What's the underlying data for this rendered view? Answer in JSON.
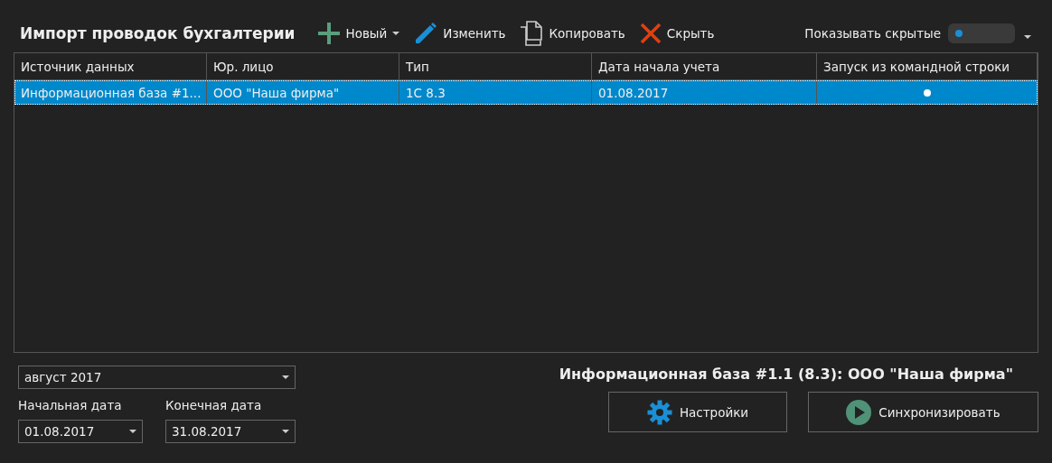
{
  "title": "Импорт проводок бухгалтерии",
  "toolbar": [
    {
      "kind": "add",
      "label": "Новый",
      "dropdown": true
    },
    {
      "kind": "edit",
      "label": "Изменить",
      "dropdown": false
    },
    {
      "kind": "copy",
      "label": "Копировать",
      "dropdown": false
    },
    {
      "kind": "hide",
      "label": "Скрыть",
      "dropdown": false
    }
  ],
  "show_hidden": {
    "label": "Показывать скрытые",
    "on": false
  },
  "table": {
    "columns": [
      "Источник данных",
      "Юр. лицо",
      "Тип",
      "Дата начала учета",
      "Запуск из командной строки"
    ],
    "rows": [
      {
        "cells": [
          "Информационная база #1...",
          "ООО \"Наша фирма\"",
          "1С 8.3",
          "01.08.2017"
        ],
        "command_line": true,
        "selected": true
      }
    ]
  },
  "period": {
    "value": "август 2017"
  },
  "start_date": {
    "label": "Начальная дата",
    "value": "01.08.2017"
  },
  "end_date": {
    "label": "Конечная дата",
    "value": "31.08.2017"
  },
  "selected_title": "Информационная база #1.1 (8.3): ООО \"Наша фирма\"",
  "buttons": [
    {
      "kind": "settings",
      "label": "Настройки"
    },
    {
      "kind": "sync",
      "label": "Синхронизировать"
    }
  ]
}
